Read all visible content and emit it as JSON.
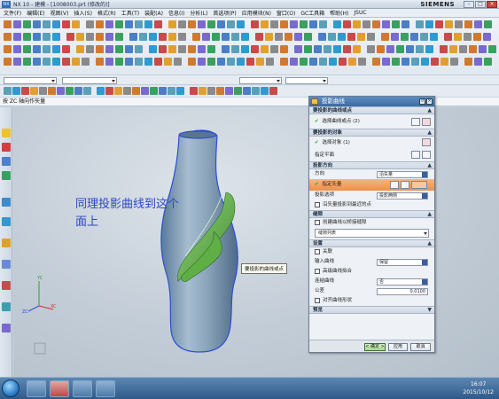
{
  "window": {
    "title": "NX 10 - 建模 - [1008003.prt (修改的)]",
    "brand": "SIEMENS",
    "buttons": {
      "minimize": "–",
      "maximize": "□",
      "close": "×"
    }
  },
  "menubar": {
    "items": [
      "文件(F)",
      "编辑(E)",
      "视图(V)",
      "插入(S)",
      "格式(R)",
      "工具(T)",
      "装配(A)",
      "信息(I)",
      "分析(L)",
      "首选项(P)",
      "应用模块(N)",
      "窗口(O)",
      "GC工具箱",
      "帮助(H)",
      "JSUC"
    ]
  },
  "prompt": {
    "text": "按 ZC 轴向作矢量"
  },
  "viewport": {
    "annotation": "同理投影曲线到这个\n面上",
    "tooltip": "要投影的曲线或点",
    "triad": {
      "x": "XC",
      "y": "YC",
      "z": "ZC"
    }
  },
  "dialog": {
    "title": "投影曲线",
    "sections": {
      "curves": {
        "header": "要投影的曲线或点",
        "select_label": "选择曲线或点 (2)"
      },
      "objects": {
        "header": "要投影的对象",
        "select_label": "选择对象 (1)",
        "plane_label": "指定平面"
      },
      "direction": {
        "header": "投影方向",
        "direction_label": "方向",
        "direction_value": "沿矢量",
        "vector_label": "指定矢量",
        "options_label": "投影选项",
        "options_value": "投影两侧",
        "cb_label": "沿矢量投影到最近的点"
      },
      "gap": {
        "header": "缝隙",
        "cb_label": "创建曲线以桥接缝隙",
        "list_value": "缝隙列表"
      },
      "settings": {
        "header": "设置",
        "assoc_label": "关联",
        "input_label": "输入曲线",
        "input_value": "保留",
        "high_label": "高级曲线拟合",
        "join_label": "连结曲线",
        "join_value": "否",
        "tolerance_label": "公差",
        "tolerance_value": "0.0100",
        "symmetric_label": "对齐曲线形状"
      },
      "preview": {
        "header": "预览"
      }
    },
    "buttons": {
      "ok": "< 确定 >",
      "apply": "应用",
      "cancel": "取消"
    }
  },
  "taskbar": {
    "time": "16:07",
    "date": "2015/10/12"
  },
  "colors": {
    "accent_blue": "#3b6aa3",
    "highlight_orange": "#ee8f4a",
    "annotation_blue": "#2c46c4",
    "surface_green": "#4aa83a"
  }
}
